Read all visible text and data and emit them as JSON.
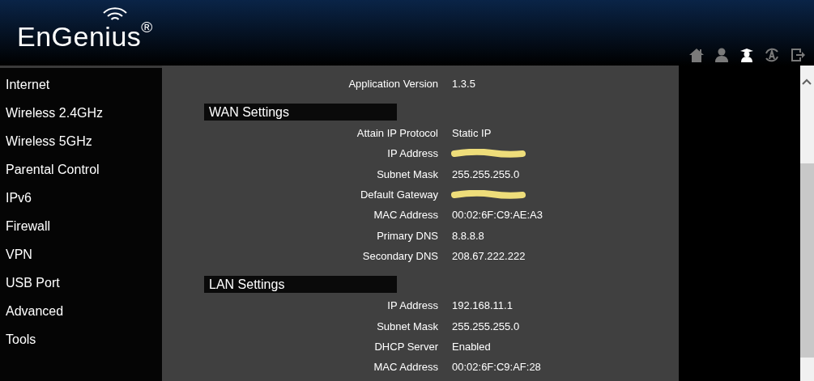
{
  "logo": {
    "text": "EnGenius",
    "mark": "®"
  },
  "toolbar": [
    {
      "kind": "home",
      "selected": false
    },
    {
      "kind": "user",
      "selected": false
    },
    {
      "kind": "wizard",
      "selected": true
    },
    {
      "kind": "refresh",
      "selected": false
    },
    {
      "kind": "logout",
      "selected": false
    }
  ],
  "sidebar": {
    "items": [
      "Internet",
      "Wireless 2.4GHz",
      "Wireless 5GHz",
      "Parental Control",
      "IPv6",
      "Firewall",
      "VPN",
      "USB Port",
      "Advanced",
      "Tools"
    ]
  },
  "content": {
    "rows": [
      {
        "label": "Application Version",
        "value": "1.3.5"
      }
    ],
    "sections": [
      {
        "title": "WAN Settings",
        "rows": [
          {
            "label": "Attain IP Protocol",
            "value": "Static IP",
            "redacted": false
          },
          {
            "label": "IP Address",
            "redacted": true
          },
          {
            "label": "Subnet Mask",
            "value": "255.255.255.0",
            "redacted": false
          },
          {
            "label": "Default Gateway",
            "redacted": true
          },
          {
            "label": "MAC Address",
            "value": "00:02:6F:C9:AE:A3",
            "redacted": false
          },
          {
            "label": "Primary DNS",
            "value": "8.8.8.8",
            "redacted": false
          },
          {
            "label": "Secondary DNS",
            "value": "208.67.222.222",
            "redacted": false
          }
        ]
      },
      {
        "title": "LAN Settings",
        "rows": [
          {
            "label": "IP Address",
            "value": "192.168.11.1",
            "redacted": false
          },
          {
            "label": "Subnet Mask",
            "value": "255.255.255.0",
            "redacted": false
          },
          {
            "label": "DHCP Server",
            "value": "Enabled",
            "redacted": false
          },
          {
            "label": "MAC Address",
            "value": "00:02:6F:C9:AF:28",
            "redacted": false
          }
        ]
      }
    ]
  }
}
